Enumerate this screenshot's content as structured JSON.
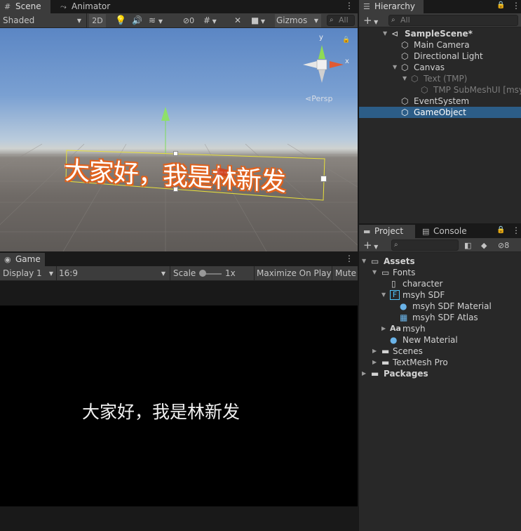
{
  "scene_panel": {
    "tabs": [
      {
        "label": "Scene",
        "icon": "grid-icon"
      },
      {
        "label": "Animator",
        "icon": "animator-icon"
      }
    ],
    "toolbar": {
      "shading_mode": "Shaded",
      "mode_2d": "2D",
      "hidden_count": "0",
      "gizmos_label": "Gizmos",
      "search_placeholder": "All"
    },
    "gizmo": {
      "axis_y": "y",
      "axis_x": "x",
      "projection": "Persp"
    },
    "selected_text": "大家好，我是林新发"
  },
  "game_panel": {
    "tab_label": "Game",
    "toolbar": {
      "display": "Display 1",
      "aspect": "16:9",
      "scale_label": "Scale",
      "scale_value": "1x",
      "maximize": "Maximize On Play",
      "mute": "Mute"
    },
    "rendered_text": "大家好，我是林新发"
  },
  "hierarchy": {
    "tab_label": "Hierarchy",
    "search_placeholder": "All",
    "items": [
      {
        "label": "SampleScene*",
        "depth": 0,
        "expanded": true,
        "kind": "scene"
      },
      {
        "label": "Main Camera",
        "depth": 1,
        "kind": "object"
      },
      {
        "label": "Directional Light",
        "depth": 1,
        "kind": "object"
      },
      {
        "label": "Canvas",
        "depth": 1,
        "expanded": true,
        "kind": "object"
      },
      {
        "label": "Text (TMP)",
        "depth": 2,
        "expanded": true,
        "kind": "object",
        "inactive": true
      },
      {
        "label": "TMP SubMeshUI [msy",
        "depth": 3,
        "kind": "object",
        "inactive": true
      },
      {
        "label": "EventSystem",
        "depth": 1,
        "kind": "object"
      },
      {
        "label": "GameObject",
        "depth": 1,
        "kind": "object",
        "selected": true
      }
    ]
  },
  "project": {
    "tabs": [
      {
        "label": "Project"
      },
      {
        "label": "Console"
      }
    ],
    "hidden_count": "8",
    "tree": [
      {
        "label": "Assets",
        "depth": 0,
        "expanded": true,
        "icon": "folder-open-icon",
        "bold": true
      },
      {
        "label": "Fonts",
        "depth": 1,
        "expanded": true,
        "icon": "folder-open-icon"
      },
      {
        "label": "character",
        "depth": 2,
        "icon": "text-file-icon"
      },
      {
        "label": "msyh SDF",
        "depth": 2,
        "expanded": true,
        "icon": "font-asset-icon"
      },
      {
        "label": "msyh SDF Material",
        "depth": 3,
        "icon": "material-icon"
      },
      {
        "label": "msyh SDF Atlas",
        "depth": 3,
        "icon": "texture-icon"
      },
      {
        "label": "msyh",
        "depth": 2,
        "collapsed": true,
        "icon": "font-icon"
      },
      {
        "label": "New Material",
        "depth": 2,
        "icon": "material-icon"
      },
      {
        "label": "Scenes",
        "depth": 1,
        "collapsed": true,
        "icon": "folder-icon"
      },
      {
        "label": "TextMesh Pro",
        "depth": 1,
        "collapsed": true,
        "icon": "folder-icon"
      },
      {
        "label": "Packages",
        "depth": 0,
        "collapsed": true,
        "icon": "folder-icon",
        "bold": true
      }
    ]
  },
  "colors": {
    "selection": "#2c5d87",
    "panel_bg": "#282828",
    "toolbar_bg": "#3c3c3c",
    "text_outline": "#e0621e",
    "rect_outline": "#e8e03a"
  }
}
